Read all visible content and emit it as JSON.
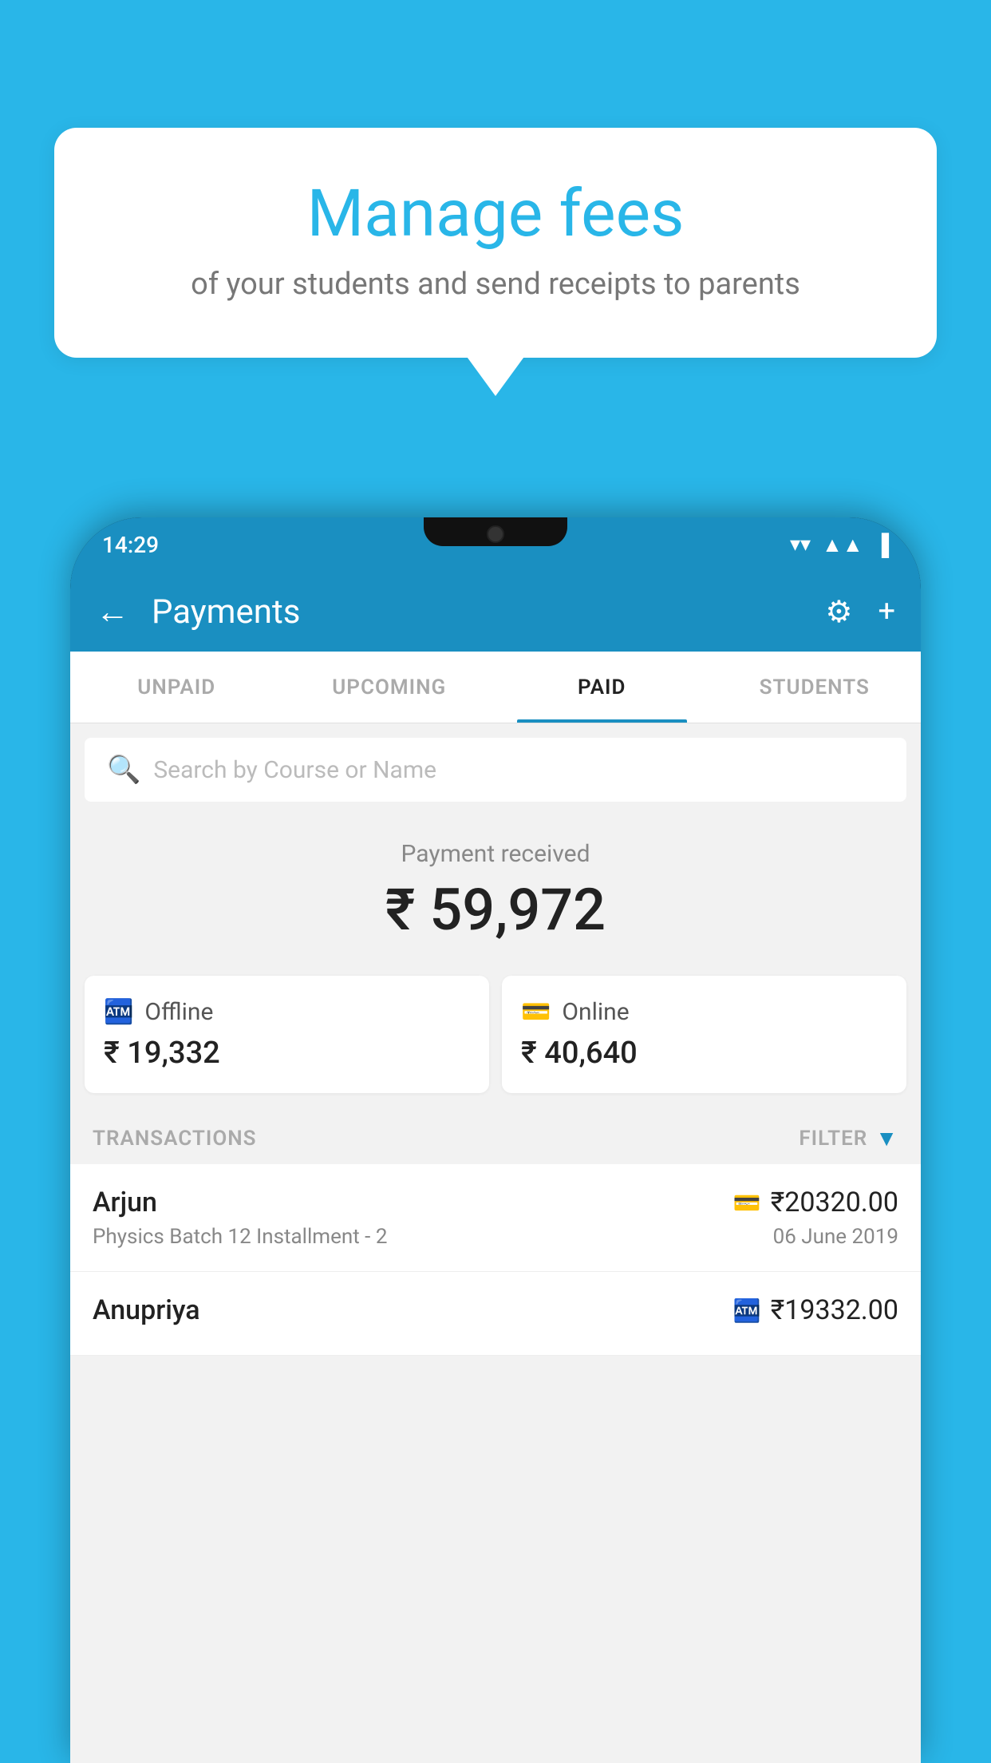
{
  "background_color": "#29b6e8",
  "speech_bubble": {
    "title": "Manage fees",
    "subtitle": "of your students and send receipts to parents"
  },
  "status_bar": {
    "time": "14:29",
    "wifi": "▼",
    "signal": "▲",
    "battery": "▌"
  },
  "app_bar": {
    "title": "Payments",
    "back_label": "←",
    "settings_label": "⚙",
    "add_label": "+"
  },
  "tabs": [
    {
      "label": "UNPAID",
      "active": false
    },
    {
      "label": "UPCOMING",
      "active": false
    },
    {
      "label": "PAID",
      "active": true
    },
    {
      "label": "STUDENTS",
      "active": false
    }
  ],
  "search": {
    "placeholder": "Search by Course or Name"
  },
  "payment_summary": {
    "label": "Payment received",
    "amount": "₹ 59,972",
    "offline_label": "Offline",
    "offline_amount": "₹ 19,332",
    "online_label": "Online",
    "online_amount": "₹ 40,640"
  },
  "transactions_section": {
    "label": "TRANSACTIONS",
    "filter_label": "FILTER"
  },
  "transactions": [
    {
      "name": "Arjun",
      "description": "Physics Batch 12 Installment - 2",
      "amount": "₹20320.00",
      "date": "06 June 2019",
      "method": "online"
    },
    {
      "name": "Anupriya",
      "description": "",
      "amount": "₹19332.00",
      "date": "",
      "method": "offline"
    }
  ]
}
